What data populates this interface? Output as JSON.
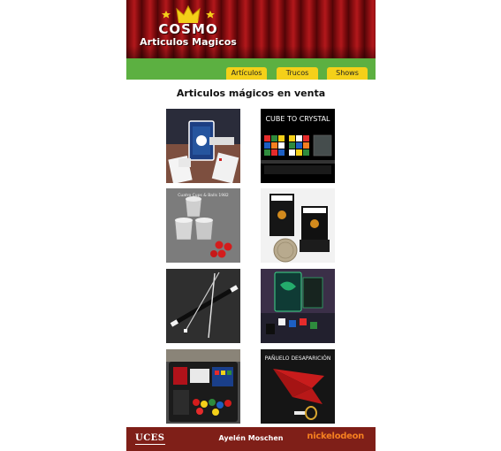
{
  "header": {
    "logo_title": "COSMO",
    "logo_subtitle": "Articulos Magicos"
  },
  "nav": {
    "items": [
      {
        "label": "Artículos"
      },
      {
        "label": "Trucos"
      },
      {
        "label": "Shows"
      }
    ]
  },
  "main": {
    "title": "Articulos mágicos en venta",
    "products": [
      {
        "icon": "playing-cards-image"
      },
      {
        "icon": "cube-to-crystal-image",
        "caption": "CUBE TO CRYSTAL"
      },
      {
        "icon": "cups-and-balls-image",
        "caption": "Cuatro Cups & Balls 1982"
      },
      {
        "icon": "coin-box-image"
      },
      {
        "icon": "magic-wands-image"
      },
      {
        "icon": "card-deck-dice-image"
      },
      {
        "icon": "magic-kit-case-image"
      },
      {
        "icon": "vanishing-handkerchief-image",
        "caption": "PAÑUELO DESAPARICIÓN"
      }
    ]
  },
  "footer": {
    "logo_left": "UCES",
    "author": "Ayelén Moschen",
    "logo_right": "nickelodeon"
  },
  "colors": {
    "curtain": "#8f0f12",
    "nav_green": "#5cb041",
    "nav_button": "#f4d019",
    "footer": "#7f1f18",
    "nick_orange": "#f57f20"
  }
}
